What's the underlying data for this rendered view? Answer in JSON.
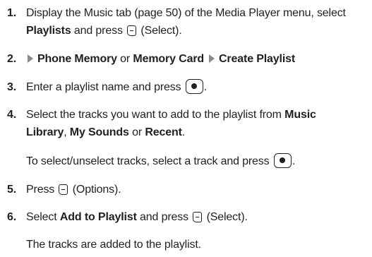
{
  "steps": [
    {
      "number": "1.",
      "line1_text": "Display the Music tab (page 50) of the Media Player menu, select",
      "line2_bold": "Playlists",
      "line2_mid": " and press ",
      "line2_tail": " (Select)."
    },
    {
      "number": "2.",
      "part1_bold": "Phone Memory",
      "part2": " or ",
      "part3_bold": "Memory Card",
      "part4_bold": "Create Playlist"
    },
    {
      "number": "3.",
      "text": "Enter a playlist name and press ",
      "tail": "."
    },
    {
      "number": "4.",
      "line1_text": "Select the tracks you want to add to the playlist from ",
      "line1_bold": "Music",
      "line2_bold1": "Library",
      "line2_sep1": ", ",
      "line2_bold2": "My Sounds",
      "line2_sep2": " or ",
      "line2_bold3": "Recent",
      "line2_tail": ".",
      "note_text": "To select/unselect tracks, select a track and press ",
      "note_tail": "."
    },
    {
      "number": "5.",
      "text": "Press ",
      "tail": " (Options)."
    },
    {
      "number": "6.",
      "text": "Select ",
      "bold": "Add to Playlist",
      "mid": " and press ",
      "tail": " (Select)."
    }
  ],
  "closing_text": "The tracks are added to the playlist.",
  "icons": {
    "softkey": "right-soft-key-icon",
    "center": "center-select-key-icon",
    "arrow": "menu-arrow-icon"
  },
  "colors": {
    "text": "#231f20",
    "arrow": "#8a8a8a"
  }
}
